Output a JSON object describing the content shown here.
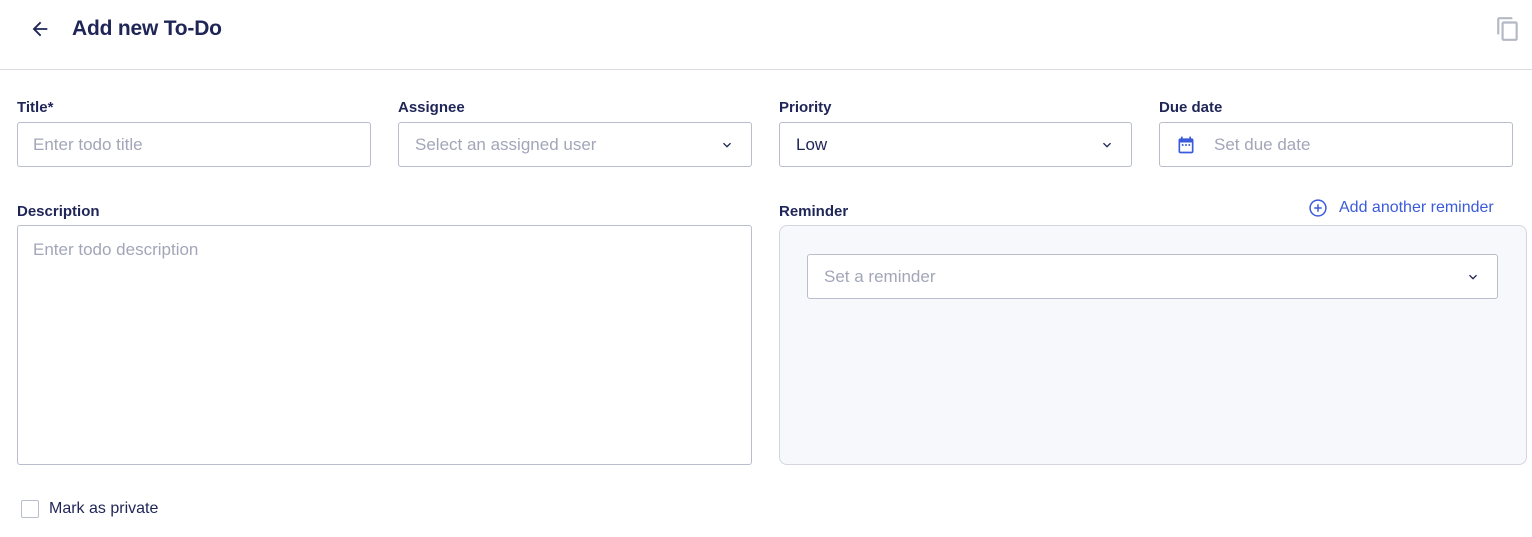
{
  "header": {
    "title": "Add new To-Do",
    "back_icon": "arrow-left-icon",
    "copy_icon": "copy-icon"
  },
  "form": {
    "title_field": {
      "label": "Title*",
      "placeholder": "Enter todo title",
      "value": ""
    },
    "assignee_field": {
      "label": "Assignee",
      "placeholder": "Select an assigned user"
    },
    "priority_field": {
      "label": "Priority",
      "value": "Low"
    },
    "due_date_field": {
      "label": "Due date",
      "placeholder": "Set due date",
      "icon": "calendar-icon"
    },
    "description_field": {
      "label": "Description",
      "placeholder": "Enter todo description",
      "value": ""
    },
    "reminder": {
      "label": "Reminder",
      "add_label": "Add another reminder",
      "add_icon": "plus-circle-icon",
      "select_placeholder": "Set a reminder"
    },
    "private_checkbox": {
      "label": "Mark as private",
      "checked": false
    }
  },
  "colors": {
    "text_primary": "#1f2557",
    "placeholder": "#a2a6b8",
    "accent": "#3b5bdb",
    "border": "#b9bdcc",
    "panel_bg": "#f7f8fc"
  }
}
